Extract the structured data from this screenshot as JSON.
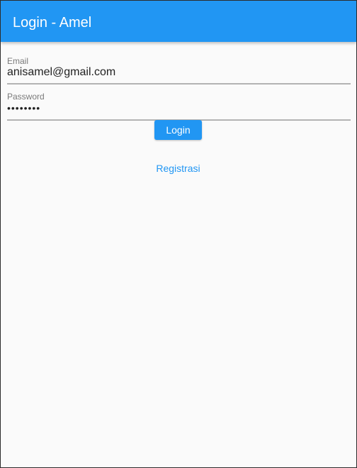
{
  "appbar": {
    "title": "Login - Amel",
    "color": "#2196f3"
  },
  "form": {
    "email": {
      "label": "Email",
      "value": "anisamel@gmail.com"
    },
    "password": {
      "label": "Password",
      "value": "••••••••"
    },
    "login_button_label": "Login",
    "register_link_label": "Registrasi"
  }
}
